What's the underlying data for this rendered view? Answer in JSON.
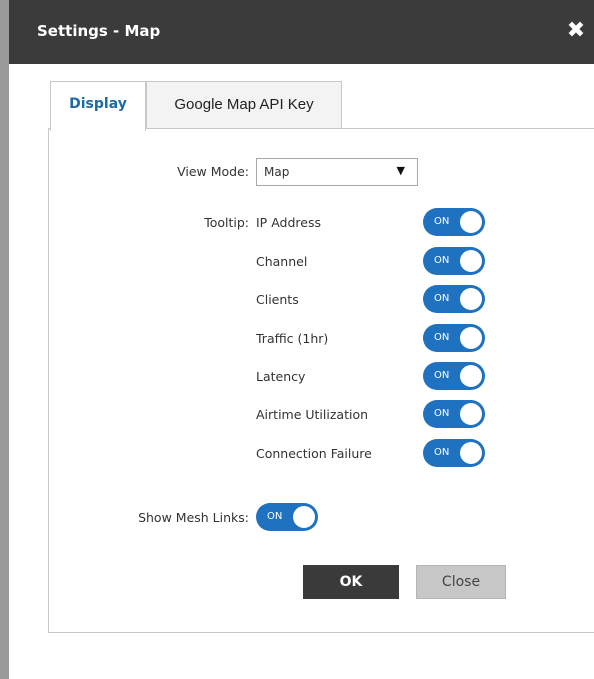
{
  "dialog": {
    "title": "Settings - Map",
    "close_icon": "✖"
  },
  "tabs": [
    {
      "label": "Display",
      "active": true
    },
    {
      "label": "Google Map API Key",
      "active": false
    }
  ],
  "display": {
    "view_mode": {
      "label": "View Mode:",
      "selected": "Map",
      "caret": "▼"
    },
    "tooltip_label": "Tooltip:",
    "tooltip_items": [
      {
        "label": "IP Address",
        "toggle": "ON"
      },
      {
        "label": "Channel",
        "toggle": "ON"
      },
      {
        "label": "Clients",
        "toggle": "ON"
      },
      {
        "label": "Traffic (1hr)",
        "toggle": "ON"
      },
      {
        "label": "Latency",
        "toggle": "ON"
      },
      {
        "label": "Airtime Utilization",
        "toggle": "ON"
      },
      {
        "label": "Connection Failure",
        "toggle": "ON"
      }
    ],
    "show_mesh_links": {
      "label": "Show Mesh Links:",
      "toggle": "ON"
    }
  },
  "buttons": {
    "ok": "OK",
    "close": "Close"
  },
  "colors": {
    "title_bar": "#3b3b3b",
    "toggle_on": "#1f72c0",
    "active_tab_text": "#1d6aa5",
    "ok_button": "#3a3a3a",
    "close_button": "#c7c7c7"
  }
}
